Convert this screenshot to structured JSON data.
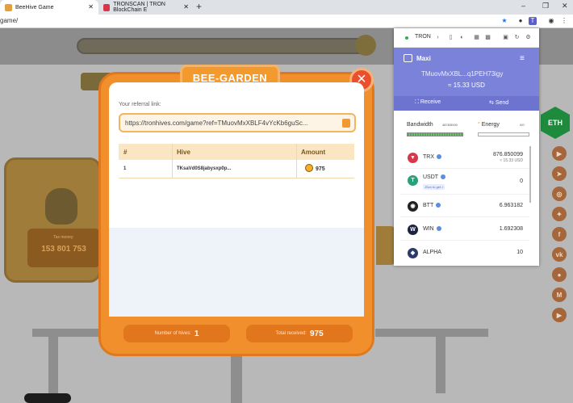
{
  "browser": {
    "tabs": [
      {
        "title": "BeeHive Game",
        "active": true
      },
      {
        "title": "TRONSCAN | TRON BlockChain E",
        "active": false
      }
    ],
    "url": "game/"
  },
  "game": {
    "left_card": {
      "label": "Tax money:",
      "value": "153 801 753"
    },
    "sidebar_badge": "ETH"
  },
  "modal": {
    "title": "BEE-GARDEN",
    "close": "×",
    "referral_label": "Your referral link:",
    "referral_value": "https://tronhives.com/game?ref=TMuovMxXBLF4vYcKb6guSc...",
    "table": {
      "headers": [
        "#",
        "Hive",
        "Amount"
      ],
      "rows": [
        {
          "index": "1",
          "hive": "TKsaVd0S8jabysxp0p...",
          "amount": "975"
        }
      ]
    },
    "footer": {
      "hives_label": "Number of hives:",
      "hives_value": "1",
      "received_label": "Total received:",
      "received_value": "975"
    }
  },
  "wallet": {
    "network": "TRON",
    "account_name": "Maxi",
    "address": "TMuovMxXBL...q1PEH73igy",
    "balance": "≈ 15.33 USD",
    "receive_label": "Receive",
    "send_label": "Send",
    "bandwidth_label": "Bandwidth",
    "bandwidth_value": "4878/5000",
    "energy_label": "Energy",
    "energy_value": "0/0",
    "tokens": [
      {
        "symbol": "TRX",
        "amount": "876.850099",
        "usd": "≈ 15.33 USD",
        "color": "#d8364a",
        "glyph": "▼"
      },
      {
        "symbol": "USDT",
        "amount": "0",
        "tag": "JScn to get >",
        "color": "#26a17b",
        "glyph": "T"
      },
      {
        "symbol": "BTT",
        "amount": "6.963182",
        "color": "#222222",
        "glyph": "◉"
      },
      {
        "symbol": "WIN",
        "amount": "1.692308",
        "color": "#1c2340",
        "glyph": "W"
      },
      {
        "symbol": "ALPHA",
        "amount": "10",
        "color": "#2a3a6a",
        "glyph": "◆"
      }
    ]
  }
}
